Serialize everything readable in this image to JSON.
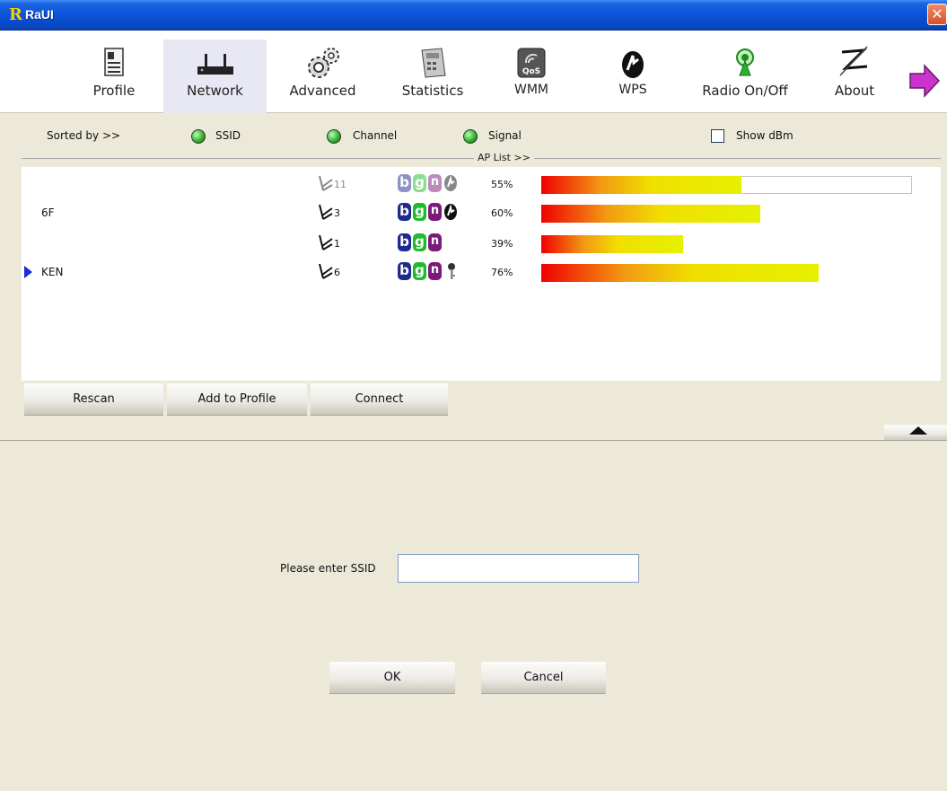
{
  "window": {
    "logo": "R",
    "title": "RaUI",
    "close": "✕"
  },
  "toolbar": {
    "items": [
      {
        "label": "Profile",
        "icon": "profile-icon"
      },
      {
        "label": "Network",
        "icon": "network-icon"
      },
      {
        "label": "Advanced",
        "icon": "gears-icon"
      },
      {
        "label": "Statistics",
        "icon": "calculator-icon"
      },
      {
        "label": "WMM",
        "icon": "qos-icon"
      },
      {
        "label": "WPS",
        "icon": "wps-icon"
      },
      {
        "label": "Radio On/Off",
        "icon": "radio-icon"
      },
      {
        "label": "About",
        "icon": "about-icon"
      }
    ],
    "next_icon": "arrow-right-icon"
  },
  "sort": {
    "label": "Sorted by >>",
    "ssid": "SSID",
    "channel": "Channel",
    "signal": "Signal",
    "show_dbm": "Show dBm"
  },
  "aplist": {
    "label": "AP List >>",
    "rows": [
      {
        "ssid": "",
        "channel": "11",
        "modes": [
          "b",
          "g",
          "n"
        ],
        "security": "wps-icon",
        "signal": "55%",
        "signal_value": 0.55,
        "faded": true
      },
      {
        "ssid": "6F",
        "channel": "3",
        "modes": [
          "b",
          "g",
          "n"
        ],
        "security": "wps-icon",
        "signal": "60%",
        "signal_value": 0.6,
        "faded": false
      },
      {
        "ssid": "",
        "channel": "1",
        "modes": [
          "b",
          "g",
          "n"
        ],
        "security": "",
        "signal": "39%",
        "signal_value": 0.39,
        "faded": false
      },
      {
        "ssid": "KEN",
        "channel": "6",
        "modes": [
          "b",
          "g",
          "n"
        ],
        "security": "key-icon",
        "signal": "76%",
        "signal_value": 0.76,
        "faded": false,
        "selected": true
      }
    ]
  },
  "buttons": {
    "rescan": "Rescan",
    "add_profile": "Add to Profile",
    "connect": "Connect",
    "ok": "OK",
    "cancel": "Cancel"
  },
  "form": {
    "ssid_label": "Please enter SSID",
    "ssid_value": ""
  }
}
